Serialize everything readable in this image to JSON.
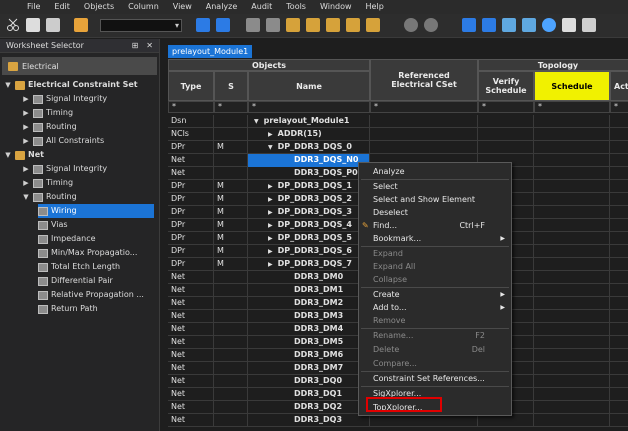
{
  "menubar": {
    "items": [
      "File",
      "Edit",
      "Objects",
      "Column",
      "View",
      "Analyze",
      "Audit",
      "Tools",
      "Window",
      "Help"
    ]
  },
  "left_pane": {
    "title": "Worksheet Selector",
    "tab": "Electrical",
    "tree": [
      {
        "label": "Electrical Constraint Set",
        "expanded": true
      },
      {
        "label": "Signal Integrity"
      },
      {
        "label": "Timing"
      },
      {
        "label": "Routing"
      },
      {
        "label": "All Constraints"
      },
      {
        "label": "Net",
        "expanded": true
      },
      {
        "label": "Signal Integrity"
      },
      {
        "label": "Timing"
      },
      {
        "label": "Routing",
        "expanded": true
      },
      {
        "label": "Wiring"
      },
      {
        "label": "Vias"
      },
      {
        "label": "Impedance"
      },
      {
        "label": "Min/Max Propagatio..."
      },
      {
        "label": "Total Etch Length"
      },
      {
        "label": "Differential Pair"
      },
      {
        "label": "Relative Propagation ..."
      },
      {
        "label": "Return Path"
      }
    ]
  },
  "document_tab": "prelayout_Module1",
  "grid": {
    "headers": {
      "objects": "Objects",
      "type": "Type",
      "s": "S",
      "name": "Name",
      "referenced": "Referenced Electrical CSet",
      "topology": "Topology",
      "verify": "Verify Schedule",
      "schedule": "Schedule",
      "actual": "Actu"
    },
    "filters": {
      "type": "*",
      "s": "*",
      "name": "*",
      "ref": "*",
      "verify": "*",
      "schedule": "*",
      "actual": "*"
    },
    "rows": [
      {
        "type": "Dsn",
        "s": "",
        "name": "prelayout_Module1",
        "arrow": "▼"
      },
      {
        "type": "NCls",
        "s": "",
        "name": "ADDR(15)",
        "arrow": "▶"
      },
      {
        "type": "DPr",
        "s": "M",
        "name": "DP_DDR3_DQS_0",
        "arrow": "▼"
      },
      {
        "type": "Net",
        "s": "",
        "name": "DDR3_DQS_N0",
        "arrow": "",
        "selected": true
      },
      {
        "type": "Net",
        "s": "",
        "name": "DDR3_DQS_P0",
        "arrow": ""
      },
      {
        "type": "DPr",
        "s": "M",
        "name": "DP_DDR3_DQS_1",
        "arrow": "▶"
      },
      {
        "type": "DPr",
        "s": "M",
        "name": "DP_DDR3_DQS_2",
        "arrow": "▶"
      },
      {
        "type": "DPr",
        "s": "M",
        "name": "DP_DDR3_DQS_3",
        "arrow": "▶"
      },
      {
        "type": "DPr",
        "s": "M",
        "name": "DP_DDR3_DQS_4",
        "arrow": "▶"
      },
      {
        "type": "DPr",
        "s": "M",
        "name": "DP_DDR3_DQS_5",
        "arrow": "▶"
      },
      {
        "type": "DPr",
        "s": "M",
        "name": "DP_DDR3_DQS_6",
        "arrow": "▶"
      },
      {
        "type": "DPr",
        "s": "M",
        "name": "DP_DDR3_DQS_7",
        "arrow": "▶"
      },
      {
        "type": "Net",
        "s": "",
        "name": "DDR3_DM0",
        "arrow": ""
      },
      {
        "type": "Net",
        "s": "",
        "name": "DDR3_DM1",
        "arrow": ""
      },
      {
        "type": "Net",
        "s": "",
        "name": "DDR3_DM2",
        "arrow": ""
      },
      {
        "type": "Net",
        "s": "",
        "name": "DDR3_DM3",
        "arrow": ""
      },
      {
        "type": "Net",
        "s": "",
        "name": "DDR3_DM4",
        "arrow": ""
      },
      {
        "type": "Net",
        "s": "",
        "name": "DDR3_DM5",
        "arrow": ""
      },
      {
        "type": "Net",
        "s": "",
        "name": "DDR3_DM6",
        "arrow": ""
      },
      {
        "type": "Net",
        "s": "",
        "name": "DDR3_DM7",
        "arrow": ""
      },
      {
        "type": "Net",
        "s": "",
        "name": "DDR3_DQ0",
        "arrow": ""
      },
      {
        "type": "Net",
        "s": "",
        "name": "DDR3_DQ1",
        "arrow": ""
      },
      {
        "type": "Net",
        "s": "",
        "name": "DDR3_DQ2",
        "arrow": ""
      },
      {
        "type": "Net",
        "s": "",
        "name": "DDR3_DQ3",
        "arrow": ""
      }
    ]
  },
  "context_menu": {
    "items": [
      {
        "label": "Analyze"
      },
      {
        "label": "Select"
      },
      {
        "label": "Select and Show Element"
      },
      {
        "label": "Deselect"
      },
      {
        "label": "Find...",
        "shortcut": "Ctrl+F"
      },
      {
        "label": "Bookmark...",
        "submenu": true
      },
      {
        "label": "Expand",
        "disabled": true
      },
      {
        "label": "Expand All",
        "disabled": true
      },
      {
        "label": "Collapse",
        "disabled": true
      },
      {
        "label": "Create",
        "submenu": true
      },
      {
        "label": "Add to...",
        "submenu": true
      },
      {
        "label": "Remove",
        "disabled": true
      },
      {
        "label": "Rename...",
        "shortcut": "F2",
        "disabled": true
      },
      {
        "label": "Delete",
        "shortcut": "Del",
        "disabled": true
      },
      {
        "label": "Compare...",
        "disabled": true
      },
      {
        "label": "Constraint Set References..."
      },
      {
        "label": "SigXplorer..."
      },
      {
        "label": "TopXplorer..."
      }
    ]
  },
  "colors": {
    "accent": "#1b74d6",
    "schedule_header": "#f1f100",
    "highlight_box": "#e00000"
  }
}
